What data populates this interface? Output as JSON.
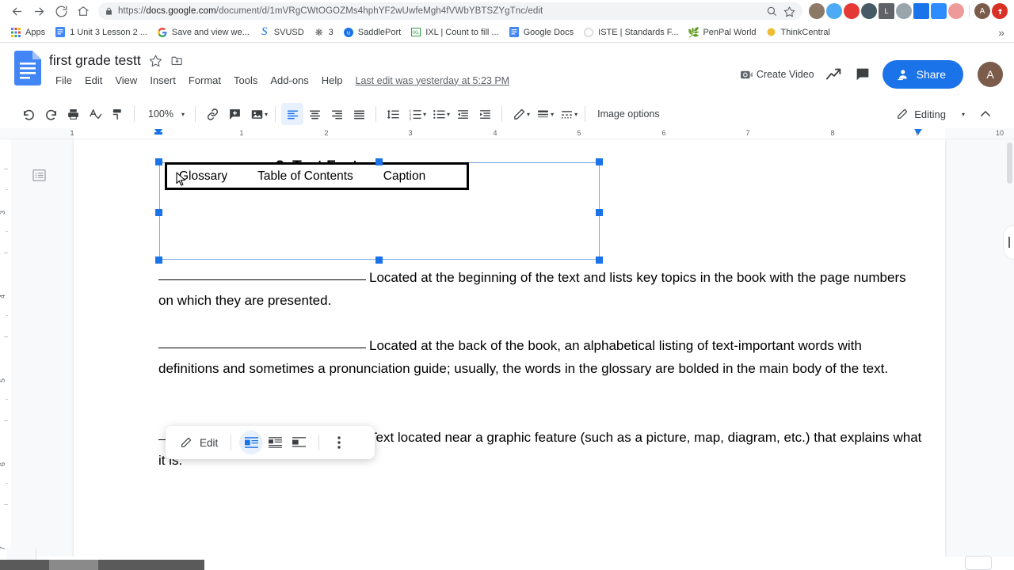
{
  "browser": {
    "nav": {
      "back_icon": "arrow-left-icon",
      "forward_icon": "arrow-right-icon",
      "reload_icon": "reload-icon",
      "home_icon": "home-icon"
    },
    "omnibox": {
      "lock_icon": "lock-icon",
      "url_scheme": "https://",
      "url_host": "docs.google.com",
      "url_path": "/document/d/1mVRgCWtOGOZMs4hphYF2wUwfeMgh4fVWbYBTSZYgTnc/edit",
      "zoom_icon": "zoom-search-icon",
      "bookmark_icon": "star-icon"
    },
    "extensions": [
      {
        "name": "extension-icon-1",
        "glyph": "",
        "color": "#5f6368"
      },
      {
        "name": "extension-icon-2",
        "glyph": "",
        "color": "#4dabf5"
      },
      {
        "name": "extension-icon-3",
        "glyph": "",
        "color": "#e53935"
      },
      {
        "name": "extension-icon-4",
        "glyph": "",
        "color": "#455a64"
      },
      {
        "name": "extension-icon-loom",
        "glyph": "L",
        "color": "#5f6368"
      },
      {
        "name": "extension-icon-6",
        "glyph": "",
        "color": "#78909c"
      },
      {
        "name": "extension-icon-screencastify",
        "glyph": "",
        "color": "#1a73e8"
      },
      {
        "name": "extension-icon-zoom",
        "glyph": "",
        "color": "#2d8cff"
      },
      {
        "name": "extension-icon-9",
        "glyph": "",
        "color": "#ef9a9a"
      }
    ],
    "profile_initial": "A",
    "profile_color": "#7b5c4b",
    "menu_color": "#d93025",
    "bookmarks": [
      {
        "label": "Apps",
        "icon": "apps-grid-icon"
      },
      {
        "label": "1 Unit 3 Lesson 2 ...",
        "icon": "google-docs-icon"
      },
      {
        "label": "Save and view we...",
        "icon": "google-g-icon"
      },
      {
        "label": "SVUSD",
        "icon": "script-s-icon"
      },
      {
        "label": "3",
        "icon": "sparkle-icon"
      },
      {
        "label": "SaddlePort",
        "icon": "saddleport-icon"
      },
      {
        "label": "IXL | Count to fill ...",
        "icon": "ixl-icon"
      },
      {
        "label": "Google Docs",
        "icon": "google-docs-icon"
      },
      {
        "label": "ISTE | Standards F...",
        "icon": "iste-icon"
      },
      {
        "label": "PenPal World",
        "icon": "penpal-icon"
      },
      {
        "label": "ThinkCentral",
        "icon": "thinkcentral-icon"
      }
    ],
    "bookmarks_overflow": "»"
  },
  "docs": {
    "logo_icon": "google-docs-logo",
    "title": "first grade testt",
    "star_icon": "star-outline-icon",
    "move_folder_icon": "move-to-folder-icon",
    "menus": [
      "File",
      "Edit",
      "View",
      "Insert",
      "Format",
      "Tools",
      "Add-ons",
      "Help"
    ],
    "last_edit": "Last edit was yesterday at 5:23 PM",
    "create_video_label": "Create Video",
    "create_video_icon": "video-camera-icon",
    "trending_icon": "trending-up-icon",
    "comment_icon": "comment-icon",
    "share_label": "Share",
    "share_icon": "person-add-icon",
    "share_color": "#1a73e8",
    "avatar_initial": "A",
    "avatar_color": "#7b5c4b"
  },
  "toolbar": {
    "undo_icon": "undo-icon",
    "redo_icon": "redo-icon",
    "print_icon": "print-icon",
    "spellcheck_icon": "spellcheck-icon",
    "paint_format_icon": "paint-format-icon",
    "zoom_value": "100%",
    "zoom_caret": "▾",
    "link_icon": "insert-link-icon",
    "comment_add_icon": "add-comment-icon",
    "image_icon": "insert-image-icon",
    "align_left_icon": "align-left-icon",
    "align_center_icon": "align-center-icon",
    "align_right_icon": "align-right-icon",
    "align_justify_icon": "align-justify-icon",
    "line_spacing_icon": "line-spacing-icon",
    "numbered_list_icon": "numbered-list-icon",
    "bulleted_list_icon": "bulleted-list-icon",
    "decrease_indent_icon": "decrease-indent-icon",
    "increase_indent_icon": "increase-indent-icon",
    "border_color_icon": "border-color-icon",
    "border_weight_icon": "border-weight-icon",
    "border_dash_icon": "border-dash-icon",
    "image_options_label": "Image options",
    "editing_label": "Editing",
    "editing_icon": "pencil-icon",
    "editing_caret": "▾",
    "collapse_icon": "chevron-up-icon"
  },
  "ruler": {
    "h_labels": [
      "1",
      "1",
      "2",
      "3",
      "4",
      "5",
      "6",
      "7",
      "8",
      "9",
      "10"
    ],
    "v_labels": [
      "3",
      "4",
      "5",
      "6",
      "7"
    ],
    "indent_marker_icon": "indent-marker-icon"
  },
  "document": {
    "outline_icon": "document-outline-icon",
    "heading_number": "2.",
    "heading_text": "Text Features",
    "image_words": [
      "Glossary",
      "Table of Contents",
      "Caption"
    ],
    "cursor_icon": "mouse-cursor-icon",
    "paragraphs": [
      {
        "blank": true,
        "text": "Located at the beginning of the text and lists key topics in the book with the page numbers on which they are presented."
      },
      {
        "blank": true,
        "text": "Located at the back of the book, an alphabetical listing of text-important words with definitions and sometimes a pronunciation guide; usually, the words in the glossary are bolded in the main body of the text."
      },
      {
        "blank": true,
        "text": "Text located near a graphic feature (such as a picture, map, diagram, etc.) that explains what it is."
      }
    ]
  },
  "image_toolbar": {
    "edit_label": "Edit",
    "edit_icon": "pencil-icon",
    "wrap_inline_icon": "wrap-text-inline-icon",
    "wrap_text_icon": "wrap-text-icon",
    "break_text_icon": "break-text-icon",
    "more_icon": "more-vertical-icon",
    "active_index": 0
  },
  "scrollbars": {
    "vertical_thumb": "vertical-scroll-thumb",
    "horizontal_thumb": "horizontal-scroll-thumb",
    "collapse_handle": "panel-collapse-handle"
  }
}
